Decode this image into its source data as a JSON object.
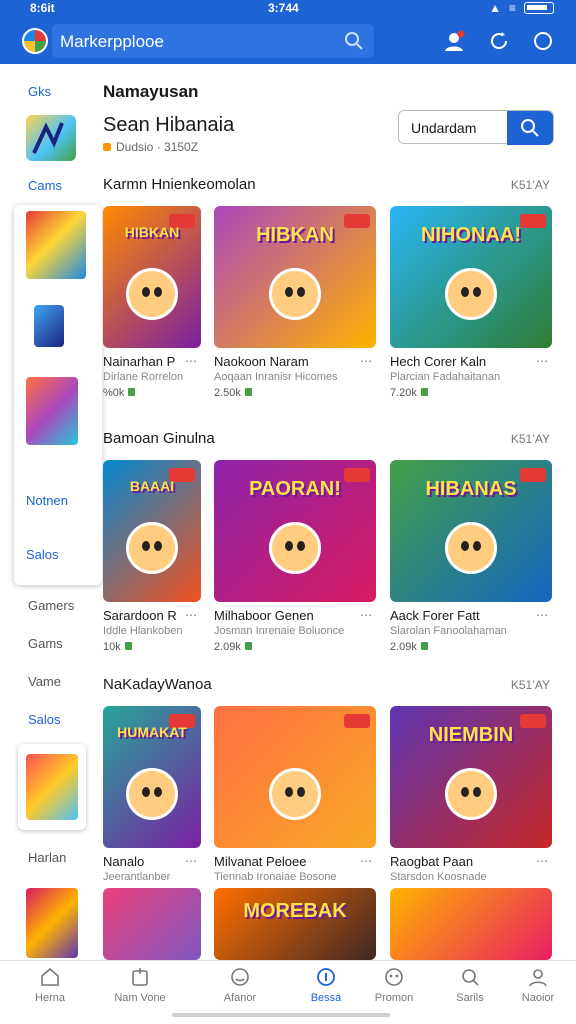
{
  "status_bar": {
    "left": "8:6it",
    "center": "3:744"
  },
  "appbar": {
    "search_text": "Markerpplooe"
  },
  "sidebar": {
    "items": [
      "Gks",
      "Cams",
      "Notnen",
      "Salos",
      "Gamers",
      "Gams",
      "Vame",
      "Salos",
      "Harlan"
    ]
  },
  "header": {
    "title": "Namayusan",
    "app_name": "Sean Hibanaia",
    "meta": "Dudsio · 3150Z",
    "update_label": "Undardam"
  },
  "sections": [
    {
      "title": "Karmn Hnienkeomolan",
      "more": "K51’AY",
      "cards": [
        {
          "name": "Nainarhan P",
          "dev": "Dirlane Rorrelon",
          "downloads": "%0k",
          "art": "HIBKAN",
          "colors": [
            "#ff8a00",
            "#7b1fa2"
          ]
        },
        {
          "name": "Naokoon Naram",
          "dev": "Aoqaan Inranisr Hicomes",
          "downloads": "2.50k",
          "art": "HIBKAN",
          "colors": [
            "#ab47bc",
            "#ffb300"
          ]
        },
        {
          "name": "Hech Corer Kaln",
          "dev": "Plarcian Fadahaitanan",
          "downloads": "7.20k",
          "art": "NIHONAA!",
          "colors": [
            "#29b6f6",
            "#2e7d32"
          ]
        }
      ]
    },
    {
      "title": "Bamoan Ginulna",
      "more": "K51’AY",
      "cards": [
        {
          "name": "Sarardoon R",
          "dev": "Iddle Hlankoben",
          "downloads": "10k",
          "art": "BAAAI",
          "colors": [
            "#0288d1",
            "#f4511e"
          ]
        },
        {
          "name": "Milhaboor Genen",
          "dev": "Josman Inrenaie Boluonce",
          "downloads": "2.09k",
          "art": "PAORAN!",
          "colors": [
            "#8e24aa",
            "#d81b60"
          ]
        },
        {
          "name": "Aack Forer Fatt",
          "dev": "Slarolan Fanoolahaman",
          "downloads": "2.09k",
          "art": "HIBANAS",
          "colors": [
            "#43a047",
            "#1565c0"
          ]
        }
      ]
    },
    {
      "title": "NaKadayWanoa",
      "more": "K51’AY",
      "cards": [
        {
          "name": "Nanalo",
          "dev": "Jeerantlanber",
          "downloads": "",
          "art": "HUMAKAT",
          "colors": [
            "#26a69a",
            "#7b1fa2"
          ]
        },
        {
          "name": "Milvanat Peloee",
          "dev": "Tiennab Ironaiae Bosone",
          "downloads": "",
          "art": "",
          "colors": [
            "#ff7043",
            "#f9a825"
          ]
        },
        {
          "name": "Raogbat Paan",
          "dev": "Starsdon Koosnade",
          "downloads": "",
          "art": "NIEMBIN",
          "colors": [
            "#5e35b1",
            "#c62828"
          ]
        }
      ]
    }
  ],
  "bottom_row": [
    {
      "art": "",
      "colors": [
        "#ec407a",
        "#7e57c2"
      ]
    },
    {
      "art": "MOREBAK",
      "colors": [
        "#ff6f00",
        "#3e2723"
      ]
    },
    {
      "art": "",
      "colors": [
        "#ffb300",
        "#e91e63"
      ]
    }
  ],
  "bottom_nav": [
    {
      "label": "Herna",
      "icon": "home-icon"
    },
    {
      "label": "Nam Vone",
      "icon": "apps-icon"
    },
    {
      "label": "Afanor",
      "icon": "smiley-icon"
    },
    {
      "label": "Bessa",
      "icon": "info-icon",
      "active": true
    },
    {
      "label": "Promon",
      "icon": "gamepad-icon"
    },
    {
      "label": "Sarils",
      "icon": "search-icon"
    },
    {
      "label": "Naoior",
      "icon": "profile-icon"
    }
  ],
  "colors": {
    "brand": "#1e63d4",
    "accent_green": "#43a047"
  }
}
